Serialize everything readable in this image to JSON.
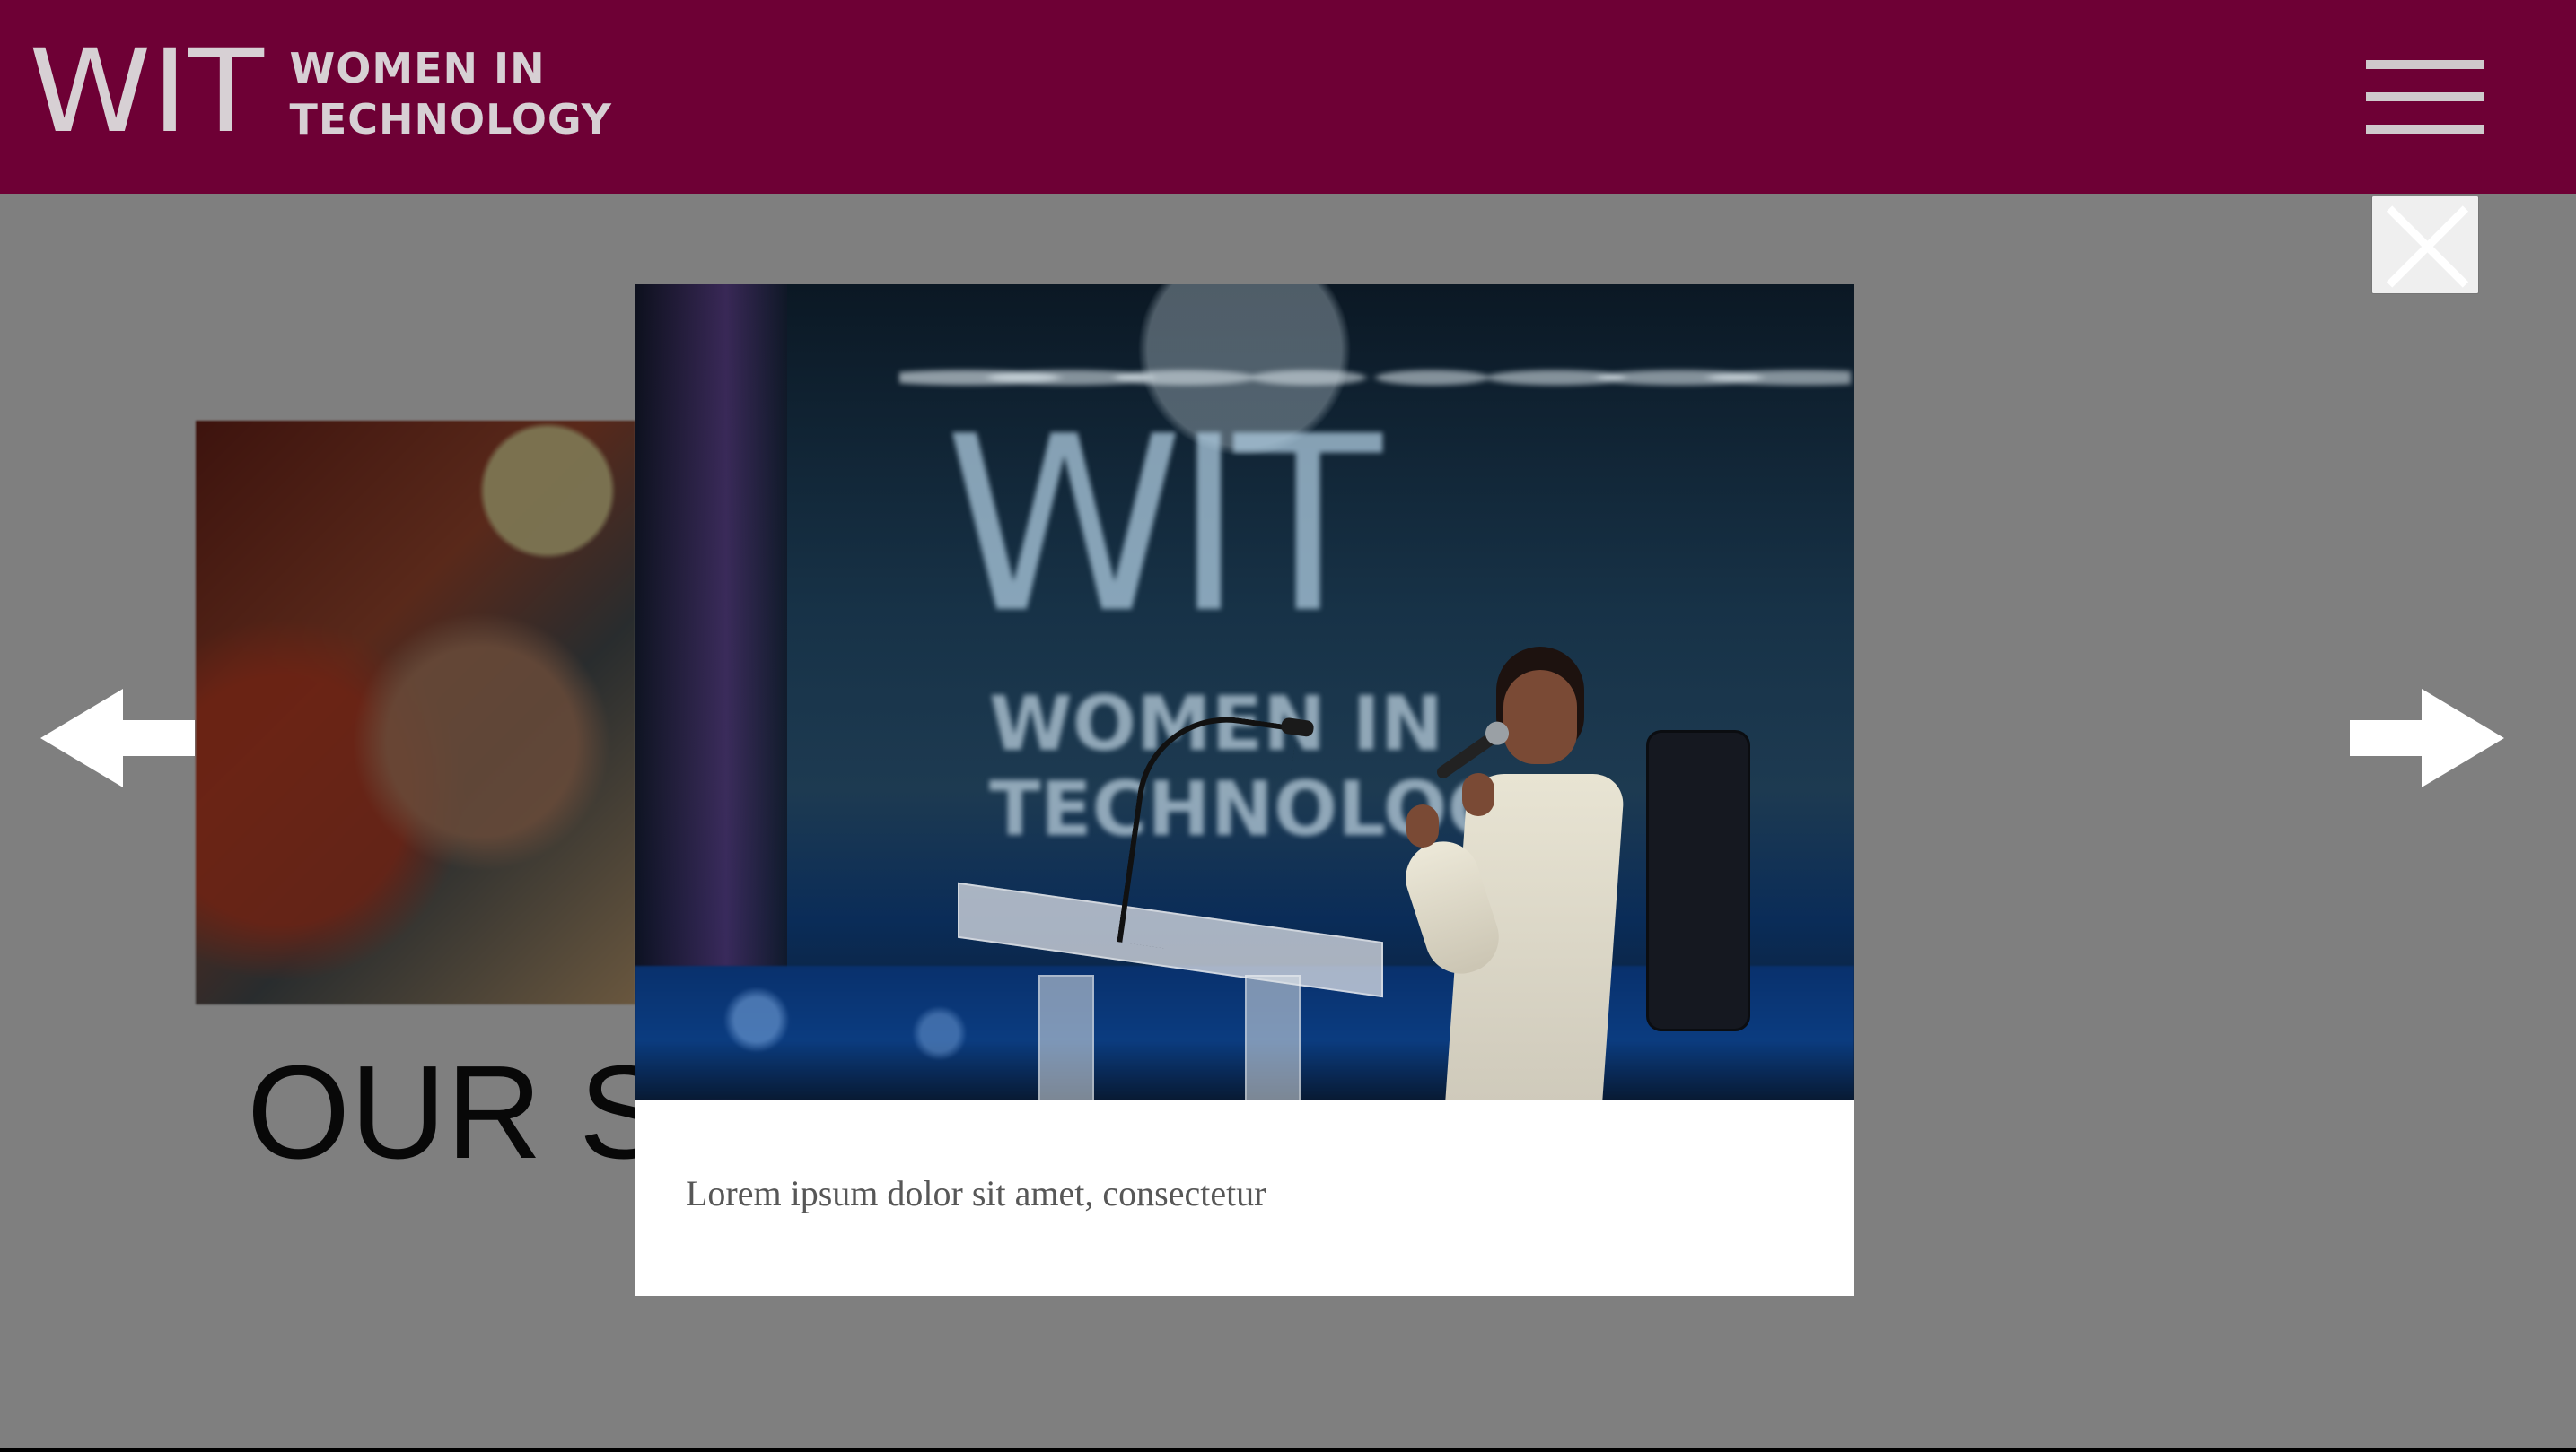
{
  "header": {
    "logo_mark": "WIT",
    "logo_line_1": "WOMEN IN",
    "logo_line_2": "TECHNOLOGY",
    "menu_icon": "hamburger-icon",
    "background_color": "#6e0035"
  },
  "page": {
    "section_title": "OUR S"
  },
  "lightbox": {
    "close_icon": "close-icon",
    "previous_icon": "arrow-left-icon",
    "next_icon": "arrow-right-icon",
    "caption": "Lorem ipsum dolor sit amet, consectetur",
    "photo": {
      "screen_title": "WIT",
      "screen_line_1": "WOMEN IN",
      "screen_line_2": "TECHNOLOGY"
    }
  },
  "colors": {
    "overlay": "rgba(0, 0, 0, 0.5)",
    "brand": "#6e0035",
    "caption_text": "#575757",
    "close_and_arrow": "#ffffff"
  }
}
